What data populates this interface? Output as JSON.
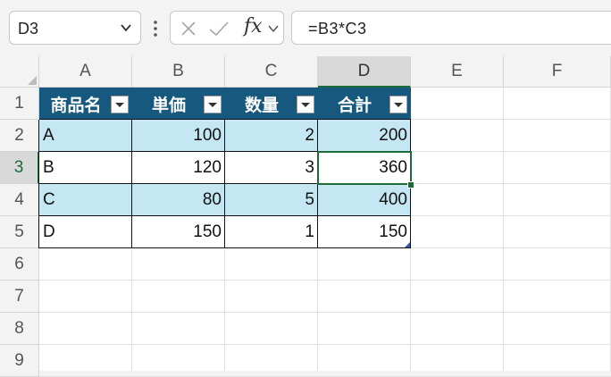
{
  "formula_bar": {
    "name_box": "D3",
    "fx_label": "fx",
    "formula": "=B3*C3"
  },
  "columns": [
    "A",
    "B",
    "C",
    "D",
    "E",
    "F"
  ],
  "rows": [
    "1",
    "2",
    "3",
    "4",
    "5",
    "6",
    "7",
    "8",
    "9"
  ],
  "selected": {
    "column": "D",
    "row": "3"
  },
  "table": {
    "headers": [
      "商品名",
      "単価",
      "数量",
      "合計"
    ],
    "rows": [
      [
        "A",
        "100",
        "2",
        "200"
      ],
      [
        "B",
        "120",
        "3",
        "360"
      ],
      [
        "C",
        "80",
        "5",
        "400"
      ],
      [
        "D",
        "150",
        "1",
        "150"
      ]
    ]
  },
  "colors": {
    "header_fill": "#17587e",
    "band_fill": "#c5e6f3",
    "selection": "#1e6b3a"
  }
}
